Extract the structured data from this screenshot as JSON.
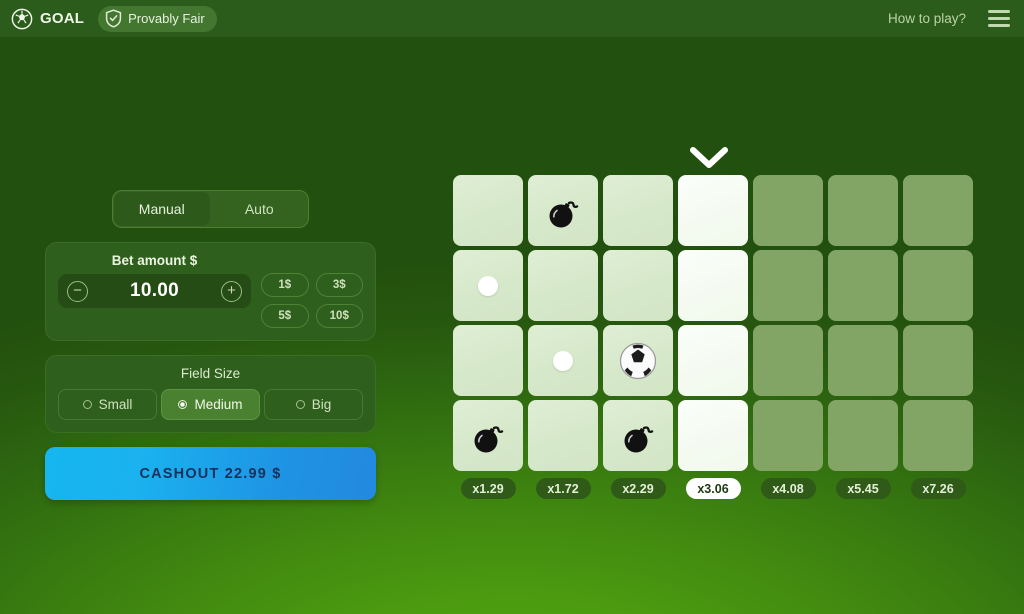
{
  "header": {
    "brand": "GOAL",
    "logo_icon": "soccer-ball-logo-icon",
    "provably_fair": "Provably Fair",
    "shield_icon": "shield-check-icon",
    "how_to_play": "How to play?",
    "menu_icon": "hamburger-menu-icon"
  },
  "controls": {
    "modes": [
      {
        "label": "Manual",
        "active": true
      },
      {
        "label": "Auto",
        "active": false
      }
    ],
    "bet": {
      "label": "Bet amount $",
      "value": "10.00",
      "decrease_icon": "minus-circle-icon",
      "increase_icon": "plus-circle-icon",
      "quick_amounts": [
        "1$",
        "3$",
        "5$",
        "10$"
      ]
    },
    "field_size": {
      "title": "Field Size",
      "options": [
        {
          "label": "Small",
          "active": false
        },
        {
          "label": "Medium",
          "active": true
        },
        {
          "label": "Big",
          "active": false
        }
      ]
    },
    "cashout": {
      "label": "CASHOUT 22.99 $"
    }
  },
  "board": {
    "chevron_icon": "chevron-down-icon",
    "columns": 7,
    "rows": 4,
    "cells": [
      {
        "state": "revealed",
        "content": "empty"
      },
      {
        "state": "revealed",
        "content": "bomb"
      },
      {
        "state": "revealed",
        "content": "empty"
      },
      {
        "state": "active",
        "content": "empty"
      },
      {
        "state": "hidden",
        "content": "empty"
      },
      {
        "state": "hidden",
        "content": "empty"
      },
      {
        "state": "hidden",
        "content": "empty"
      },
      {
        "state": "revealed",
        "content": "dot"
      },
      {
        "state": "revealed",
        "content": "empty"
      },
      {
        "state": "revealed",
        "content": "empty"
      },
      {
        "state": "active",
        "content": "empty"
      },
      {
        "state": "hidden",
        "content": "empty"
      },
      {
        "state": "hidden",
        "content": "empty"
      },
      {
        "state": "hidden",
        "content": "empty"
      },
      {
        "state": "revealed",
        "content": "empty"
      },
      {
        "state": "revealed",
        "content": "dot"
      },
      {
        "state": "revealed",
        "content": "ball"
      },
      {
        "state": "active",
        "content": "empty"
      },
      {
        "state": "hidden",
        "content": "empty"
      },
      {
        "state": "hidden",
        "content": "empty"
      },
      {
        "state": "hidden",
        "content": "empty"
      },
      {
        "state": "revealed",
        "content": "bomb"
      },
      {
        "state": "revealed",
        "content": "empty"
      },
      {
        "state": "revealed",
        "content": "bomb"
      },
      {
        "state": "active",
        "content": "empty"
      },
      {
        "state": "hidden",
        "content": "empty"
      },
      {
        "state": "hidden",
        "content": "empty"
      },
      {
        "state": "hidden",
        "content": "empty"
      }
    ],
    "multipliers": [
      {
        "label": "x1.29",
        "current": false
      },
      {
        "label": "x1.72",
        "current": false
      },
      {
        "label": "x2.29",
        "current": false
      },
      {
        "label": "x3.06",
        "current": true
      },
      {
        "label": "x4.08",
        "current": false
      },
      {
        "label": "x5.45",
        "current": false
      },
      {
        "label": "x7.26",
        "current": false
      }
    ]
  },
  "colors": {
    "topbar": "#2c5c1c",
    "panel": "#2f5f1c",
    "cell_hidden": "#82a566",
    "cell_revealed": "#d8e8cc",
    "cell_active": "#f6fbf2",
    "cashout_from": "#16b6f0",
    "cashout_to": "#2289e0",
    "multiplier_pill": "#2f5a17"
  }
}
